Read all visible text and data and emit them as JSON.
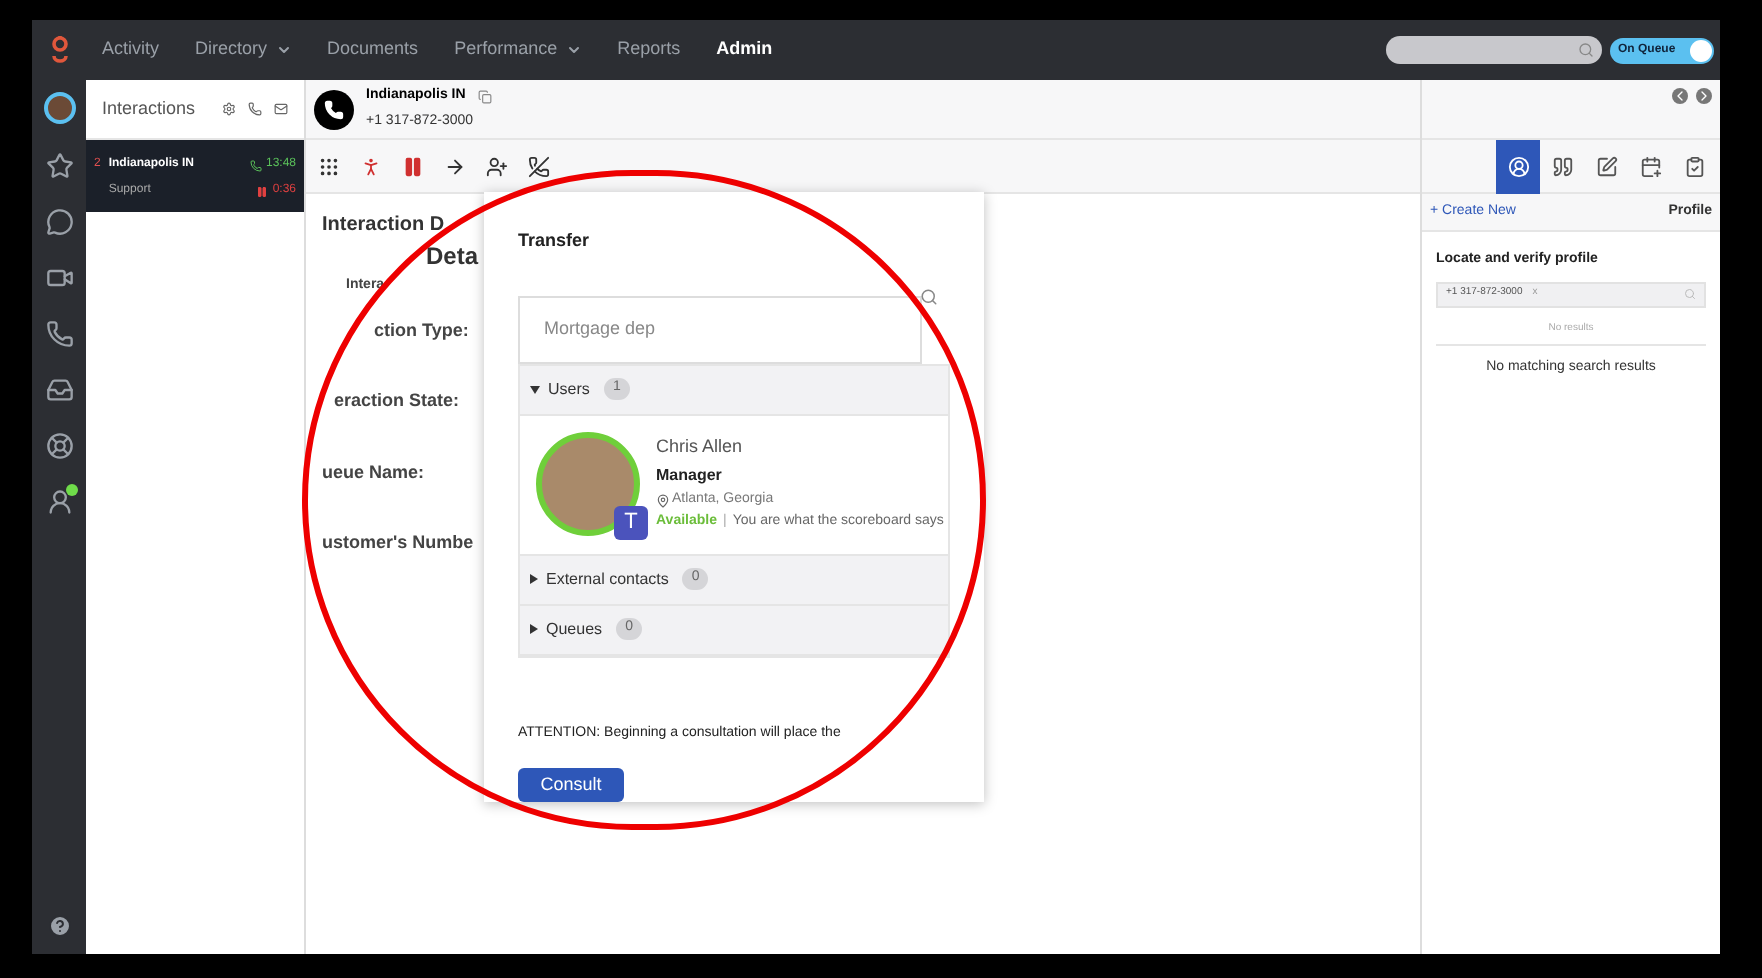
{
  "nav": [
    {
      "label": "Activity",
      "dropdown": false,
      "selected": false
    },
    {
      "label": "Directory",
      "dropdown": true,
      "selected": false
    },
    {
      "label": "Documents",
      "dropdown": false,
      "selected": false
    },
    {
      "label": "Performance",
      "dropdown": true,
      "selected": false
    },
    {
      "label": "Reports",
      "dropdown": false,
      "selected": false
    },
    {
      "label": "Admin",
      "dropdown": false,
      "selected": true
    }
  ],
  "status_toggle": {
    "label": "On Queue",
    "on": true
  },
  "interactions_panel": {
    "title": "Interactions",
    "items": [
      {
        "index": "2",
        "name": "Indianapolis IN",
        "queue": "Support",
        "talk_time": "13:48",
        "hold_time": "0:36",
        "selected": true
      }
    ]
  },
  "call_header": {
    "name": "Indianapolis IN",
    "number": "+1 317-872-3000"
  },
  "details": {
    "heading": "Interaction D",
    "heading_2": "Deta",
    "sub": "Intera",
    "fields": [
      "ction Type:",
      "eraction State:",
      "ueue Name:",
      "ustomer's Numbe"
    ]
  },
  "transfer": {
    "title": "Transfer",
    "search_value": "Mortgage dep",
    "sections": [
      {
        "label": "Users",
        "count": "1",
        "expanded": true
      },
      {
        "label": "External contacts",
        "count": "0",
        "expanded": false
      },
      {
        "label": "Queues",
        "count": "0",
        "expanded": false
      }
    ],
    "user": {
      "name": "Chris Allen",
      "title": "Manager",
      "location": "Atlanta, Georgia",
      "status": "Available",
      "separator": "|",
      "status_message": "You are what the scoreboard says",
      "badge": "T"
    },
    "notice": "ATTENTION: Beginning a consultation will place the",
    "button": "Consult"
  },
  "right_panel": {
    "tabs": [
      {
        "kind": "profile",
        "selected": true
      },
      {
        "kind": "quote",
        "selected": false
      },
      {
        "kind": "note",
        "selected": false
      },
      {
        "kind": "calendar",
        "selected": false
      },
      {
        "kind": "clipboard",
        "selected": false
      }
    ],
    "create_link": "+ Create New",
    "title": "Profile",
    "section_title": "Locate and verify profile",
    "search_chip": "+1 317-872-3000",
    "chip_remove": "x",
    "no_results": "No results",
    "message": "No matching search results"
  }
}
